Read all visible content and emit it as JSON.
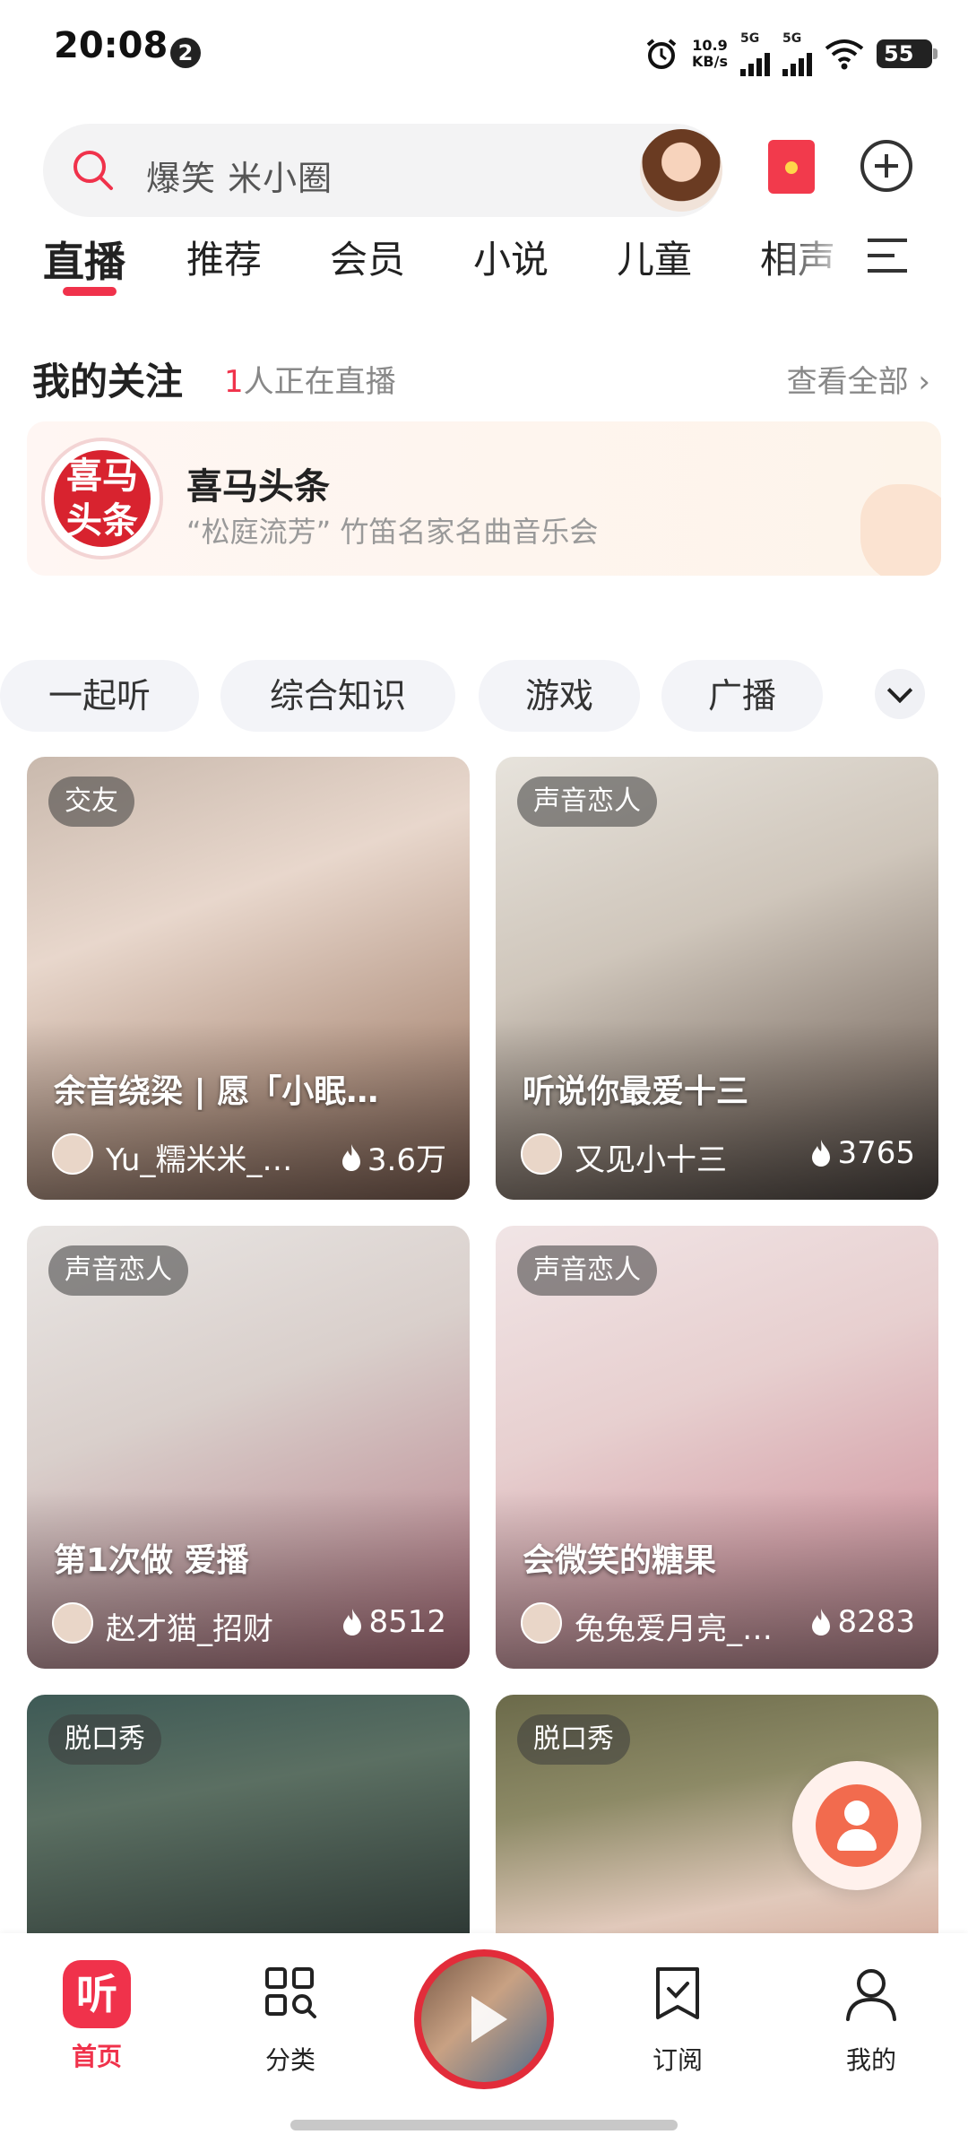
{
  "status_bar": {
    "time": "20:08",
    "notif_count": "2",
    "net_speed_value": "10.9",
    "net_speed_unit": "KB/s",
    "signal_1": "5G",
    "signal_2": "5G",
    "battery": "55"
  },
  "search": {
    "placeholder": "爆笑 米小圈",
    "icon": "search-icon",
    "accent": "#f0324b"
  },
  "tabs": [
    {
      "label": "直播",
      "active": true
    },
    {
      "label": "推荐"
    },
    {
      "label": "会员"
    },
    {
      "label": "小说"
    },
    {
      "label": "儿童"
    },
    {
      "label": "相声"
    }
  ],
  "follow": {
    "title": "我的关注",
    "live_count": "1",
    "live_suffix": "人正在直播",
    "view_all": "查看全部",
    "card": {
      "avatar_text": "喜马头条",
      "name": "喜马头条",
      "desc": "“松庭流芳” 竹笛名家名曲音乐会"
    }
  },
  "chips": [
    "一起听",
    "综合知识",
    "游戏",
    "广播"
  ],
  "cards": [
    {
      "tag": "交友",
      "title": "余音绕梁 | 愿「小眠…",
      "user": "Yu_糯米米_…",
      "hot": "3.6万"
    },
    {
      "tag": "声音恋人",
      "title": "听说你最爱十三",
      "user": "又见小十三",
      "hot": "3765"
    },
    {
      "tag": "声音恋人",
      "title": "第1次做 爱播",
      "user": "赵才猫_招财",
      "hot": "8512"
    },
    {
      "tag": "声音恋人",
      "title": "会微笑的糖果",
      "user": "兔兔爱月亮_…",
      "hot": "8283"
    },
    {
      "tag": "脱口秀",
      "title": "",
      "user": "",
      "hot": ""
    },
    {
      "tag": "脱口秀",
      "title": "",
      "user": "",
      "hot": ""
    }
  ],
  "bottom_nav": {
    "home": {
      "label": "首页",
      "icon_glyph": "听"
    },
    "category": {
      "label": "分类"
    },
    "subscribe": {
      "label": "订阅"
    },
    "mine": {
      "label": "我的"
    }
  }
}
